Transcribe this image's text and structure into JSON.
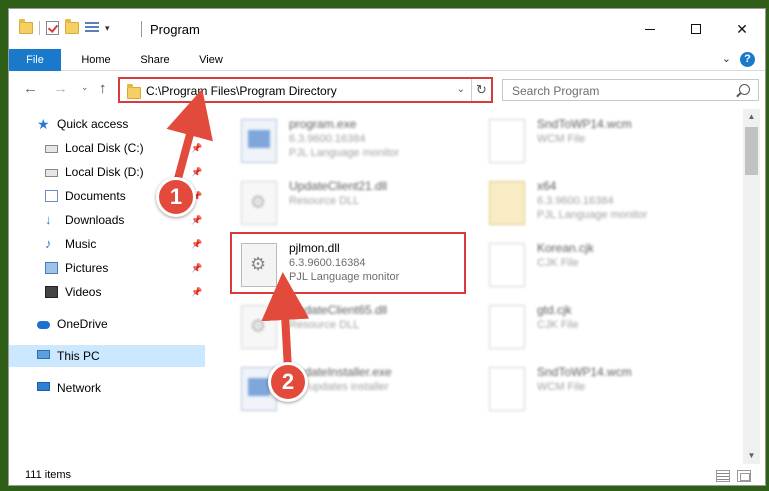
{
  "window": {
    "title": "Program",
    "qat_dropdown": "▾"
  },
  "ribbon": {
    "tabs": [
      "File",
      "Home",
      "Share",
      "View"
    ],
    "help": "?",
    "collapse": "⌄"
  },
  "nav": {
    "back": "←",
    "forward": "→",
    "recent": "⌄",
    "up": "↑",
    "address": "C:\\Program Files\\Program Directory",
    "address_dropdown": "⌄",
    "refresh": "↻",
    "search_placeholder": "Search Program"
  },
  "sidebar": {
    "items": [
      {
        "label": "Quick access"
      },
      {
        "label": "Local Disk (C:)",
        "pinned": true
      },
      {
        "label": "Local Disk (D:)",
        "pinned": true
      },
      {
        "label": "Documents",
        "pinned": true
      },
      {
        "label": "Downloads",
        "pinned": true
      },
      {
        "label": "Music",
        "pinned": true
      },
      {
        "label": "Pictures",
        "pinned": true
      },
      {
        "label": "Videos",
        "pinned": true
      },
      {
        "label": "OneDrive"
      },
      {
        "label": "This PC",
        "selected": true
      },
      {
        "label": "Network"
      }
    ],
    "pin_glyph": "📌"
  },
  "files": [
    {
      "name": "program.exe",
      "line1": "6.3.9600.16384",
      "line2": "PJL Language monitor",
      "icon": "exe-icon"
    },
    {
      "name": "SndToWP14.wcm",
      "line1": "WCM File",
      "line2": "",
      "icon": "blank-file-icon"
    },
    {
      "name": "UpdateClient21.dll",
      "line1": "Resource DLL",
      "line2": "",
      "icon": "dll-icon"
    },
    {
      "name": "x64",
      "line1": "6.3.9600.16384",
      "line2": "PJL Language monitor",
      "icon": "x64-icon"
    },
    {
      "name": "pjlmon.dll",
      "line1": "6.3.9600.16384",
      "line2": "PJL Language monitor",
      "icon": "dll-icon"
    },
    {
      "name": "Korean.cjk",
      "line1": "CJK File",
      "line2": "",
      "icon": "blank-file-icon"
    },
    {
      "name": "UpdateClient65.dll",
      "line1": "Resource DLL",
      "line2": "",
      "icon": "dll-icon"
    },
    {
      "name": "gtd.cjk",
      "line1": "CJK File",
      "line2": "",
      "icon": "blank-file-icon"
    },
    {
      "name": "UpdateInstaller.exe",
      "line1": "...V updates installer",
      "line2": "",
      "icon": "exe-icon"
    },
    {
      "name": "SndToWP14.wcm",
      "line1": "WCM File",
      "line2": "",
      "icon": "blank-file-icon"
    }
  ],
  "status": {
    "item_count": "111 items"
  },
  "annotations": {
    "badge1": "1",
    "badge2": "2",
    "color": "#e24a3c"
  },
  "colors": {
    "accent": "#1979ca",
    "highlight_border": "#d93a3a",
    "selected_bg": "#cce8ff"
  }
}
